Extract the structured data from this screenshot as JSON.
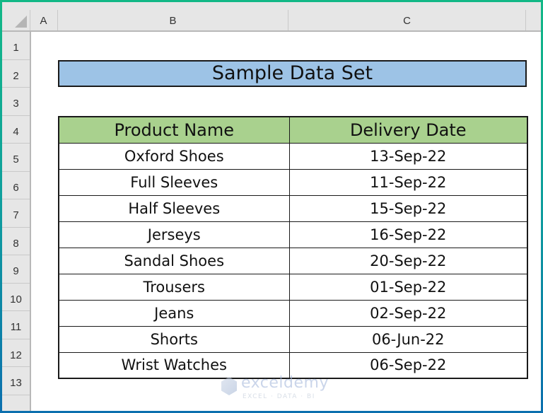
{
  "spreadsheet": {
    "columns": [
      "A",
      "B",
      "C"
    ],
    "rows": [
      "1",
      "2",
      "3",
      "4",
      "5",
      "6",
      "7",
      "8",
      "9",
      "10",
      "11",
      "12",
      "13"
    ],
    "title": "Sample Data Set",
    "table": {
      "headers": [
        "Product Name",
        "Delivery Date"
      ],
      "rows": [
        [
          "Oxford Shoes",
          "13-Sep-22"
        ],
        [
          "Full Sleeves",
          "11-Sep-22"
        ],
        [
          "Half Sleeves",
          "15-Sep-22"
        ],
        [
          "Jerseys",
          "16-Sep-22"
        ],
        [
          "Sandal Shoes",
          "20-Sep-22"
        ],
        [
          "Trousers",
          "01-Sep-22"
        ],
        [
          "Jeans",
          "02-Sep-22"
        ],
        [
          "Shorts",
          "06-Jun-22"
        ],
        [
          "Wrist Watches",
          "06-Sep-22"
        ]
      ]
    },
    "colors": {
      "title_fill": "#9dc3e6",
      "header_fill": "#a9d18e"
    }
  },
  "watermark": {
    "brand": "exceldemy",
    "tagline": "EXCEL · DATA · BI"
  }
}
